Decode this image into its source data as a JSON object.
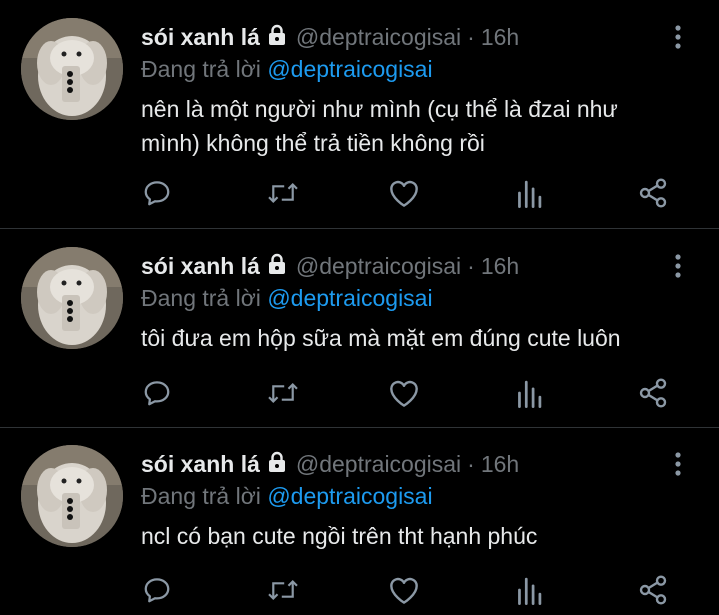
{
  "tweets": [
    {
      "name": "sói xanh lá",
      "handle": "@deptraicogisai",
      "dot": "·",
      "time": "16h",
      "reply_prefix": "Đang trả lời",
      "reply_to": "@deptraicogisai",
      "text": "nên là một người như mình (cụ thể là đzai như mình) không thể trả tiền không rồi"
    },
    {
      "name": "sói xanh lá",
      "handle": "@deptraicogisai",
      "dot": "·",
      "time": "16h",
      "reply_prefix": "Đang trả lời",
      "reply_to": "@deptraicogisai",
      "text": "tôi đưa em hộp sữa mà mặt em đúng cute luôn"
    },
    {
      "name": "sói xanh lá",
      "handle": "@deptraicogisai",
      "dot": "·",
      "time": "16h",
      "reply_prefix": "Đang trả lời",
      "reply_to": "@deptraicogisai",
      "text": "ncl có bạn cute ngồi trên tht hạnh phúc"
    }
  ],
  "icons": {
    "lock": "lock-icon",
    "more": "more-vertical-icon",
    "reply": "reply-icon",
    "retweet": "retweet-icon",
    "like": "like-icon",
    "views": "views-icon",
    "share": "share-icon"
  },
  "colors": {
    "background": "#000000",
    "text": "#e7e9ea",
    "muted": "#71767b",
    "link": "#1d9bf0",
    "divider": "#2f3336"
  }
}
